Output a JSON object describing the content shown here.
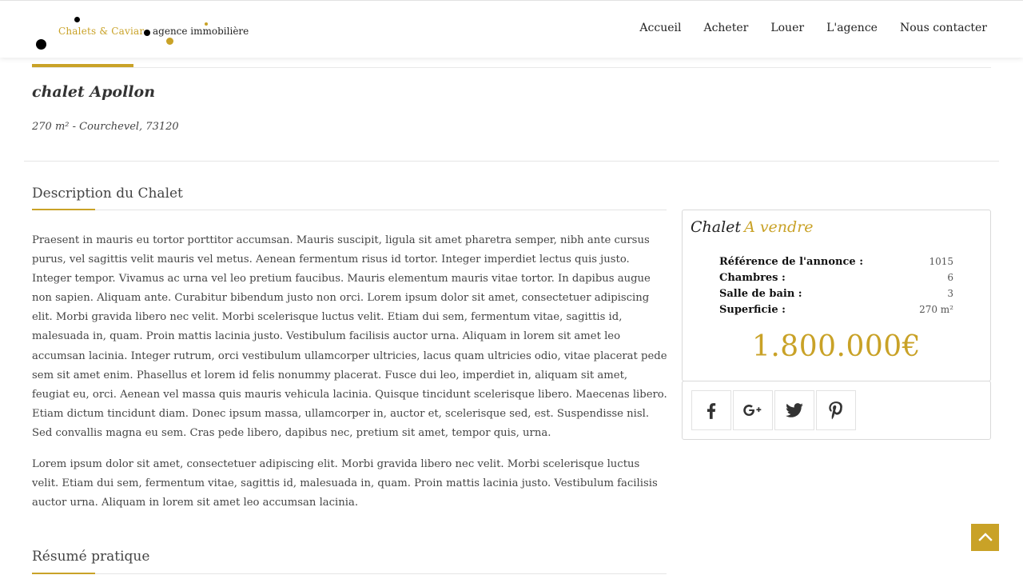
{
  "header": {
    "logo": {
      "brand": "Chalets & Caviar",
      "agency": "agence immobilière"
    },
    "nav": [
      "Accueil",
      "Acheter",
      "Louer",
      "L'agence",
      "Nous contacter"
    ]
  },
  "property": {
    "title": "chalet Apollon",
    "subtitle": "270 m² - Courchevel, 73120"
  },
  "description": {
    "title": "Description du Chalet",
    "paragraphs": [
      "Praesent in mauris eu tortor porttitor accumsan. Mauris suscipit, ligula sit amet pharetra semper, nibh ante cursus purus, vel sagittis velit mauris vel metus. Aenean fermentum risus id tortor. Integer imperdiet lectus quis justo. Integer tempor. Vivamus ac urna vel leo pretium faucibus. Mauris elementum mauris vitae tortor. In dapibus augue non sapien. Aliquam ante. Curabitur bibendum justo non orci. Lorem ipsum dolor sit amet, consectetuer adipiscing elit. Morbi gravida libero nec velit. Morbi scelerisque luctus velit. Etiam dui sem, fermentum vitae, sagittis id, malesuada in, quam. Proin mattis lacinia justo. Vestibulum facilisis auctor urna. Aliquam in lorem sit amet leo accumsan lacinia. Integer rutrum, orci vestibulum ullamcorper ultricies, lacus quam ultricies odio, vitae placerat pede sem sit amet enim. Phasellus et lorem id felis nonummy placerat. Fusce dui leo, imperdiet in, aliquam sit amet, feugiat eu, orci. Aenean vel massa quis mauris vehicula lacinia. Quisque tincidunt scelerisque libero. Maecenas libero. Etiam dictum tincidunt diam. Donec ipsum massa, ullamcorper in, auctor et, scelerisque sed, est. Suspendisse nisl. Sed convallis magna eu sem. Cras pede libero, dapibus nec, pretium sit amet, tempor quis, urna.",
      "Lorem ipsum dolor sit amet, consectetuer adipiscing elit. Morbi gravida libero nec velit. Morbi scelerisque luctus velit. Etiam dui sem, fermentum vitae, sagittis id, malesuada in, quam. Proin mattis lacinia justo. Vestibulum facilisis auctor urna. Aliquam in lorem sit amet leo accumsan lacinia."
    ]
  },
  "summary": {
    "title": "Résumé pratique"
  },
  "card": {
    "type": "Chalet",
    "status": "A vendre",
    "specs": [
      {
        "label": "Référence de l'annonce :",
        "value": "1015"
      },
      {
        "label": "Chambres :",
        "value": "6"
      },
      {
        "label": "Salle de bain :",
        "value": "3"
      },
      {
        "label": "Superficie :",
        "value": "270 m²"
      }
    ],
    "price": "1.800.000€"
  },
  "share": {
    "icons": [
      "facebook-icon",
      "google-plus-icon",
      "twitter-icon",
      "pinterest-icon"
    ]
  },
  "colors": {
    "accent": "#c9a227",
    "text": "#444444",
    "border": "#d9d9d9"
  }
}
